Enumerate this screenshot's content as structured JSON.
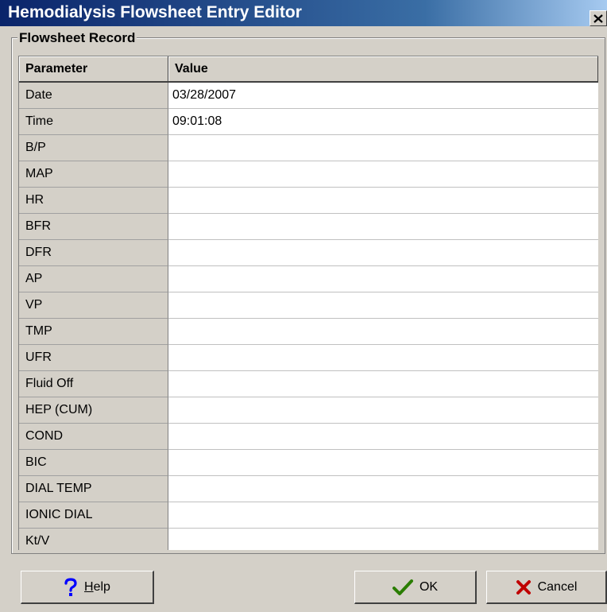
{
  "window": {
    "title": "Hemodialysis Flowsheet Entry Editor"
  },
  "frame": {
    "label": "Flowsheet Record"
  },
  "grid": {
    "headers": {
      "parameter": "Parameter",
      "value": "Value"
    },
    "rows": [
      {
        "param": "Date",
        "value": "03/28/2007"
      },
      {
        "param": "Time",
        "value": "09:01:08"
      },
      {
        "param": "B/P",
        "value": ""
      },
      {
        "param": "MAP",
        "value": ""
      },
      {
        "param": "HR",
        "value": ""
      },
      {
        "param": "BFR",
        "value": ""
      },
      {
        "param": "DFR",
        "value": ""
      },
      {
        "param": "AP",
        "value": ""
      },
      {
        "param": "VP",
        "value": ""
      },
      {
        "param": "TMP",
        "value": ""
      },
      {
        "param": "UFR",
        "value": ""
      },
      {
        "param": "Fluid Off",
        "value": ""
      },
      {
        "param": "HEP (CUM)",
        "value": ""
      },
      {
        "param": "COND",
        "value": ""
      },
      {
        "param": "BIC",
        "value": ""
      },
      {
        "param": "DIAL TEMP",
        "value": ""
      },
      {
        "param": "IONIC DIAL",
        "value": ""
      },
      {
        "param": "Kt/V",
        "value": ""
      }
    ]
  },
  "buttons": {
    "help": {
      "accel": "H",
      "rest": "elp",
      "icon": "question-icon",
      "color": "#0000ff"
    },
    "ok": {
      "label": "OK",
      "icon": "checkmark-icon",
      "color": "#2a7d00"
    },
    "cancel": {
      "label": "Cancel",
      "icon": "x-icon",
      "color": "#c00000"
    }
  },
  "colors": {
    "titlebar_start": "#0a246a",
    "titlebar_end": "#a6caf0",
    "face": "#d4d0c8"
  }
}
